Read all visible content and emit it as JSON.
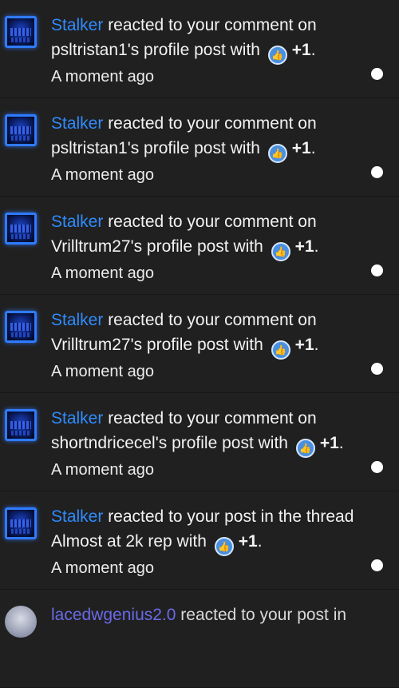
{
  "notifications": [
    {
      "user": "Stalker",
      "text_before": " reacted to your comment on psltristan1's profile post with ",
      "reaction_icon": "like-thumb-icon",
      "reaction": "+1",
      "text_after": ".",
      "time": "A moment ago"
    },
    {
      "user": "Stalker",
      "text_before": " reacted to your comment on psltristan1's profile post with ",
      "reaction_icon": "like-thumb-icon",
      "reaction": "+1",
      "text_after": ".",
      "time": "A moment ago"
    },
    {
      "user": "Stalker",
      "text_before": " reacted to your comment on Vrilltrum27's profile post with ",
      "reaction_icon": "like-thumb-icon",
      "reaction": "+1",
      "text_after": ".",
      "time": "A moment ago"
    },
    {
      "user": "Stalker",
      "text_before": " reacted to your comment on Vrilltrum27's profile post with ",
      "reaction_icon": "like-thumb-icon",
      "reaction": "+1",
      "text_after": ".",
      "time": "A moment ago"
    },
    {
      "user": "Stalker",
      "text_before": " reacted to your comment on shortndricecel's profile post with ",
      "reaction_icon": "like-thumb-icon",
      "reaction": "+1",
      "text_after": ".",
      "time": "A moment ago"
    },
    {
      "user": "Stalker",
      "text_before": " reacted to your post in the thread Almost at 2k rep with ",
      "reaction_icon": "like-thumb-icon",
      "reaction": "+1",
      "text_after": ".",
      "time": "A moment ago"
    }
  ],
  "partial_notification": {
    "user": "lacedwgenius2.0",
    "text_before": " reacted to your post in"
  }
}
